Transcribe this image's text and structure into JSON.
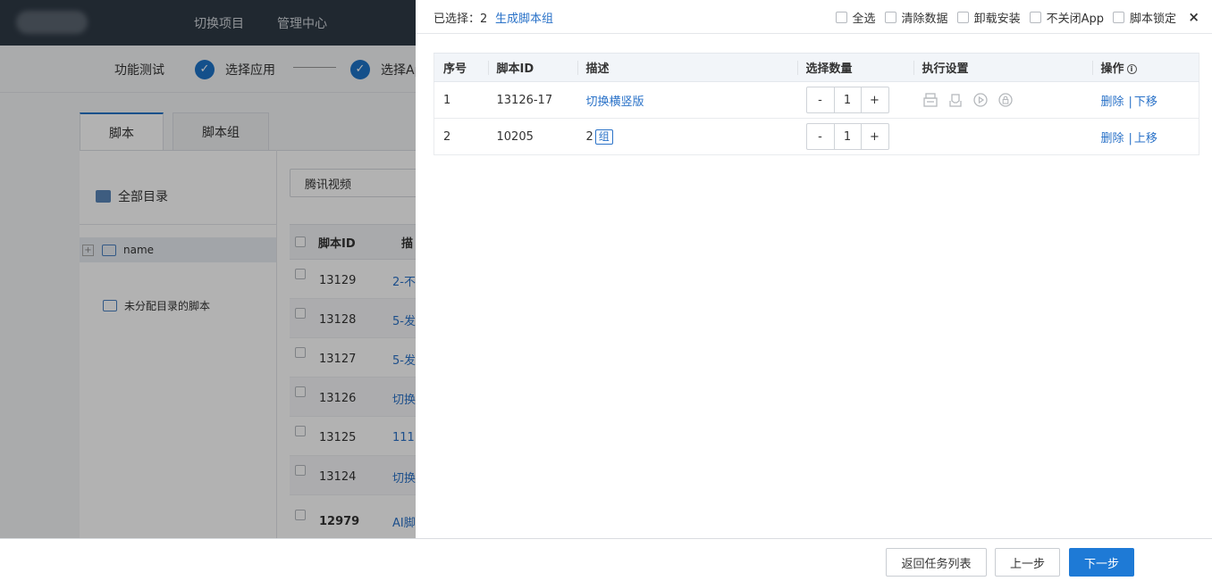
{
  "topnav": {
    "switch_project": "切换项目",
    "admin_center": "管理中心"
  },
  "steps": [
    {
      "label": "功能测试"
    },
    {
      "label": "选择应用"
    },
    {
      "label": "选择Ap"
    }
  ],
  "tabs": [
    {
      "label": "脚本"
    },
    {
      "label": "脚本组"
    }
  ],
  "tree": {
    "all": "全部目录",
    "name_item": "name",
    "unassigned": "未分配目录的脚本"
  },
  "filter": {
    "app_value": "腾讯视频"
  },
  "bg_table": {
    "col_id": "脚本ID",
    "col_desc": "描",
    "rows": [
      {
        "id": "13129",
        "desc": "2-不"
      },
      {
        "id": "13128",
        "desc": "5-发"
      },
      {
        "id": "13127",
        "desc": "5-发"
      },
      {
        "id": "13126",
        "desc": "切换"
      },
      {
        "id": "13125",
        "desc": "111"
      },
      {
        "id": "13124",
        "desc": "切换"
      },
      {
        "id": "12979",
        "desc": "AI脚"
      }
    ]
  },
  "drawer": {
    "selected_count": "已选择：2",
    "generate_group": "生成脚本组",
    "options": {
      "select_all": "全选",
      "clear_data": "清除数据",
      "uninstall_install": "卸载安装",
      "keep_app_open": "不关闭App",
      "lock_script": "脚本锁定"
    },
    "close": "×",
    "columns": {
      "index": "序号",
      "script_id": "脚本ID",
      "desc": "描述",
      "quantity": "选择数量",
      "exec": "执行设置",
      "ops": "操作"
    },
    "rows": [
      {
        "index": "1",
        "script_id": "13126-17",
        "desc": "切换横竖版",
        "badge": "",
        "qty": "1",
        "op1": "删除",
        "op2": "下移"
      },
      {
        "index": "2",
        "script_id": "10205",
        "desc": "2",
        "badge": "组",
        "qty": "1",
        "op1": "删除",
        "op2": "上移"
      }
    ],
    "stepper": {
      "minus": "-",
      "plus": "+"
    },
    "op_sep": "|"
  },
  "footer": {
    "back_to_list": "返回任务列表",
    "prev": "上一步",
    "next": "下一步"
  },
  "colors": {
    "accent": "#1e7ad6",
    "link": "#2a72c8",
    "topbar": "#2f3a46"
  }
}
